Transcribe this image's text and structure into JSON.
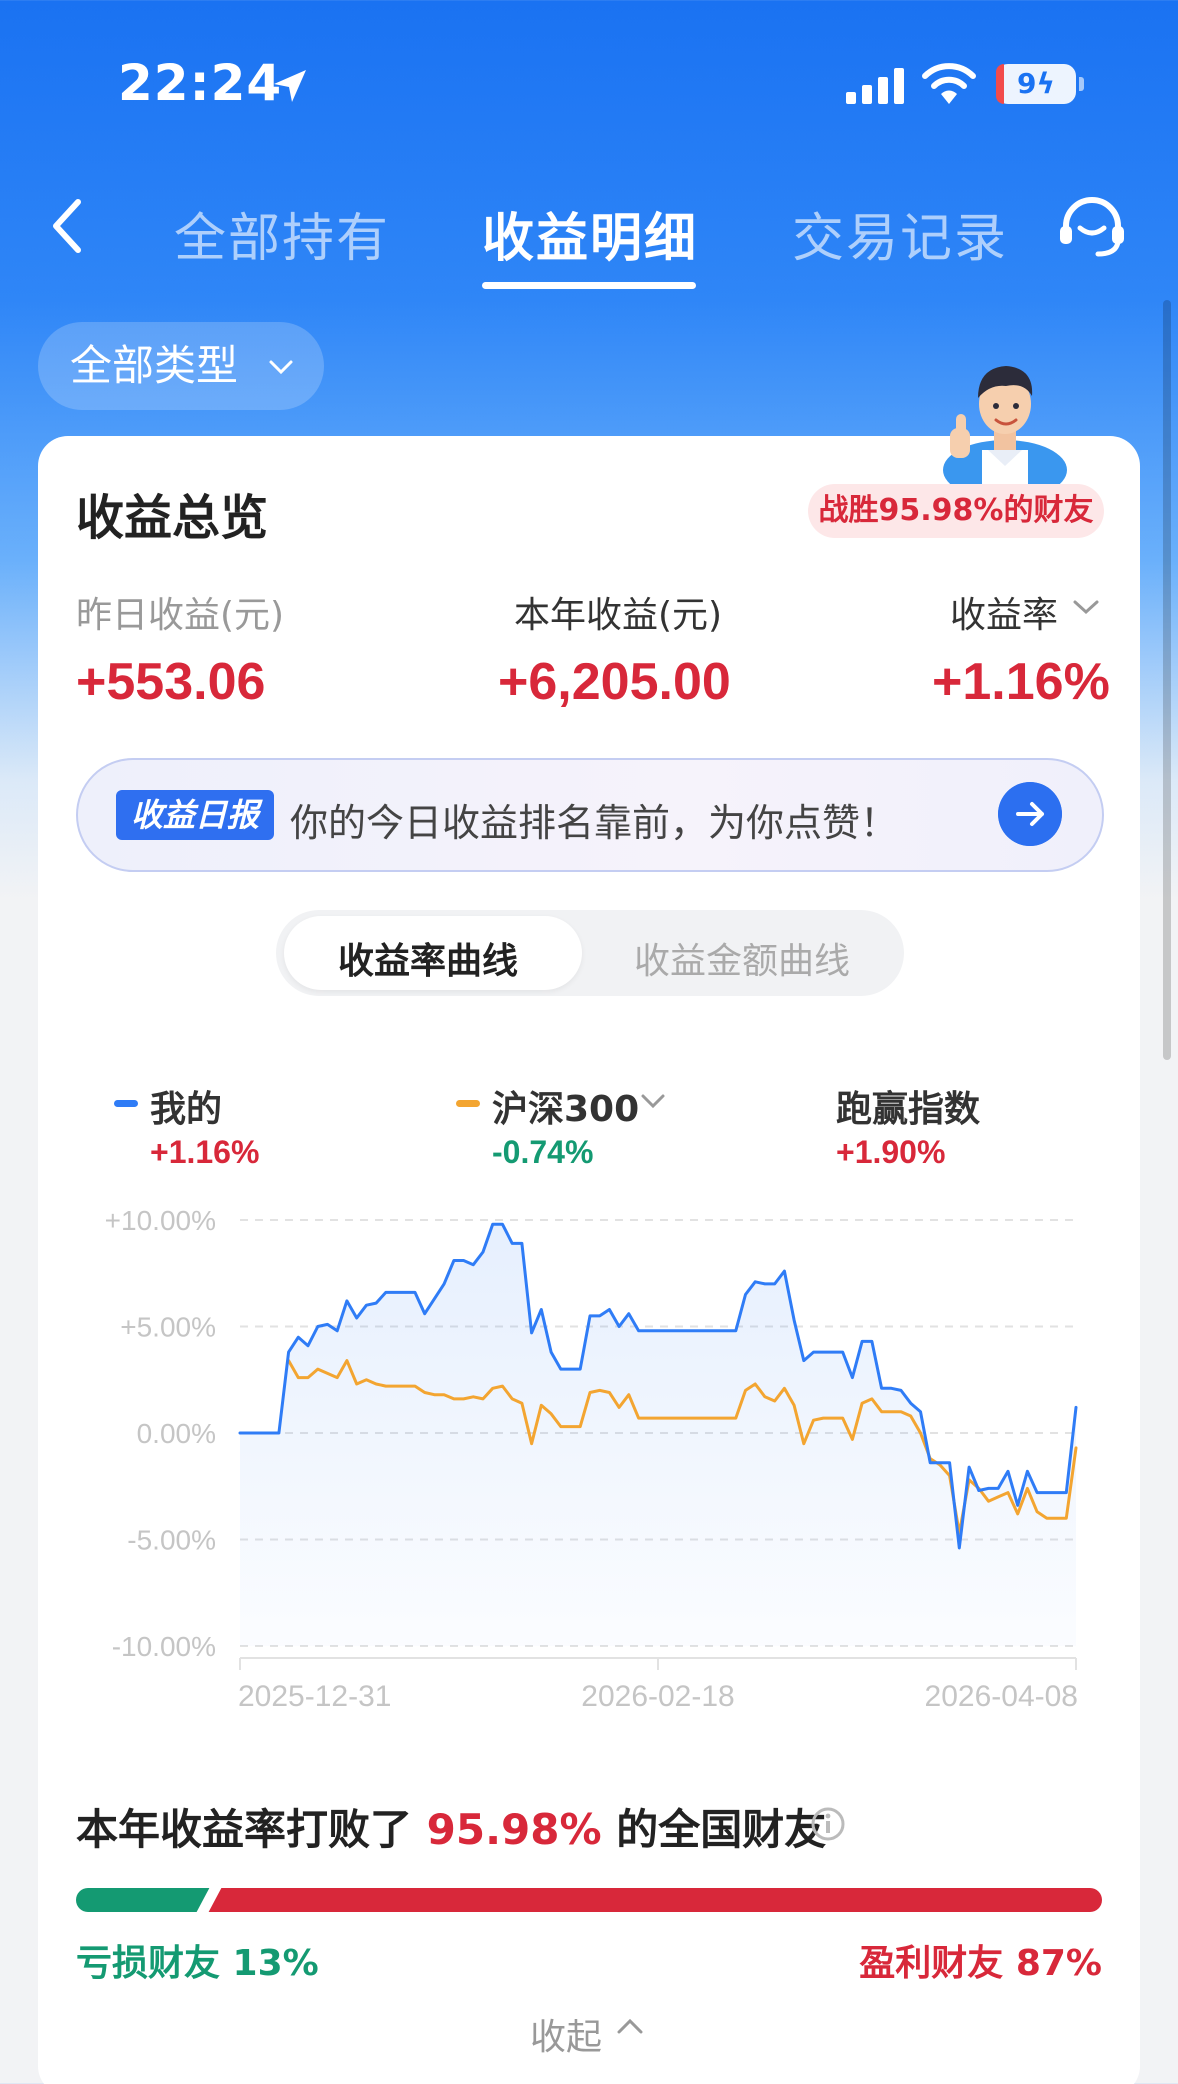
{
  "status_bar": {
    "time": "22:24",
    "battery": "9"
  },
  "nav": {
    "tabs": [
      {
        "label": "全部持有",
        "active": false
      },
      {
        "label": "收益明细",
        "active": true
      },
      {
        "label": "交易记录",
        "active": false
      }
    ]
  },
  "filter": {
    "label": "全部类型"
  },
  "overview": {
    "title": "收益总览",
    "rank_badge": "战胜95.98%的财友",
    "yesterday": {
      "label": "昨日收益(元)",
      "value": "+553.06"
    },
    "year": {
      "label": "本年收益(元)",
      "value": "+6,205.00"
    },
    "rate": {
      "label": "收益率",
      "value": "+1.16%"
    }
  },
  "daily_report": {
    "tag": "收益日报",
    "text": "你的今日收益排名靠前，为你点赞！"
  },
  "curve_tabs": {
    "active": "收益率曲线",
    "inactive": "收益金额曲线"
  },
  "legend": [
    {
      "name": "我的",
      "value": "+1.16%",
      "color": "#2f7cf6",
      "value_color": "#d8283a"
    },
    {
      "name": "沪深300",
      "value": "-0.74%",
      "color": "#f3a531",
      "value_color": "#149a72"
    },
    {
      "name": "跑赢指数",
      "value": "+1.90%",
      "value_color": "#d8283a"
    }
  ],
  "chart_data": {
    "type": "line",
    "y_ticks": [
      "+10.00%",
      "+5.00%",
      "0.00%",
      "-5.00%",
      "-10.00%"
    ],
    "ylim": [
      -10,
      10
    ],
    "x_ticks": [
      "2025-12-31",
      "2026-02-18",
      "2026-04-08"
    ],
    "grid": true,
    "series": [
      {
        "name": "我的",
        "color": "#2f7cf6",
        "values": [
          0.0,
          0.0,
          0.0,
          0.0,
          0.0,
          3.8,
          4.5,
          4.1,
          5.0,
          5.1,
          4.8,
          6.2,
          5.4,
          6.0,
          6.1,
          6.6,
          6.6,
          6.6,
          6.6,
          5.6,
          6.3,
          7.0,
          8.1,
          8.1,
          7.9,
          8.5,
          9.8,
          9.8,
          8.9,
          8.9,
          4.7,
          5.8,
          3.8,
          3.0,
          3.0,
          3.0,
          5.5,
          5.5,
          5.8,
          5.0,
          5.6,
          4.8,
          4.8,
          4.8,
          4.8,
          4.8,
          4.8,
          4.8,
          4.8,
          4.8,
          4.8,
          4.8,
          6.5,
          7.1,
          7.0,
          7.0,
          7.6,
          5.3,
          3.4,
          3.8,
          3.8,
          3.8,
          3.8,
          2.6,
          4.3,
          4.3,
          2.1,
          2.1,
          2.0,
          1.4,
          1.0,
          -1.4,
          -1.4,
          -1.4,
          -5.4,
          -1.6,
          -2.7,
          -2.6,
          -2.6,
          -1.8,
          -3.4,
          -1.8,
          -2.8,
          -2.8,
          -2.8,
          -2.8,
          1.2
        ]
      },
      {
        "name": "沪深300",
        "color": "#f3a531",
        "values": [
          null,
          null,
          null,
          null,
          null,
          3.4,
          2.6,
          2.6,
          3.0,
          2.8,
          2.6,
          3.4,
          2.3,
          2.5,
          2.3,
          2.2,
          2.2,
          2.2,
          2.2,
          1.9,
          1.8,
          1.8,
          1.6,
          1.6,
          1.7,
          1.6,
          2.1,
          2.2,
          1.6,
          1.4,
          -0.5,
          1.3,
          0.9,
          0.3,
          0.3,
          0.3,
          1.9,
          2.0,
          1.9,
          1.2,
          1.8,
          0.7,
          0.7,
          0.7,
          0.7,
          0.7,
          0.7,
          0.7,
          0.7,
          0.7,
          0.7,
          0.7,
          2.0,
          2.3,
          1.7,
          1.5,
          2.1,
          1.3,
          -0.5,
          0.6,
          0.7,
          0.7,
          0.7,
          -0.3,
          1.4,
          1.6,
          1.0,
          1.0,
          1.0,
          0.8,
          0.0,
          -1.2,
          -1.5,
          -2.0,
          -4.7,
          -2.2,
          -2.6,
          -3.2,
          -3.0,
          -2.8,
          -3.8,
          -2.6,
          -3.7,
          -4.0,
          -4.0,
          -4.0,
          -0.7
        ]
      }
    ]
  },
  "beat": {
    "prefix": "本年收益率打败了",
    "percent": "95.98%",
    "suffix": "的全国财友"
  },
  "distribution": {
    "loss_label": "亏损财友 13%",
    "profit_label": "盈利财友 87%",
    "loss_fraction": 0.13
  },
  "collapse_label": "收起"
}
